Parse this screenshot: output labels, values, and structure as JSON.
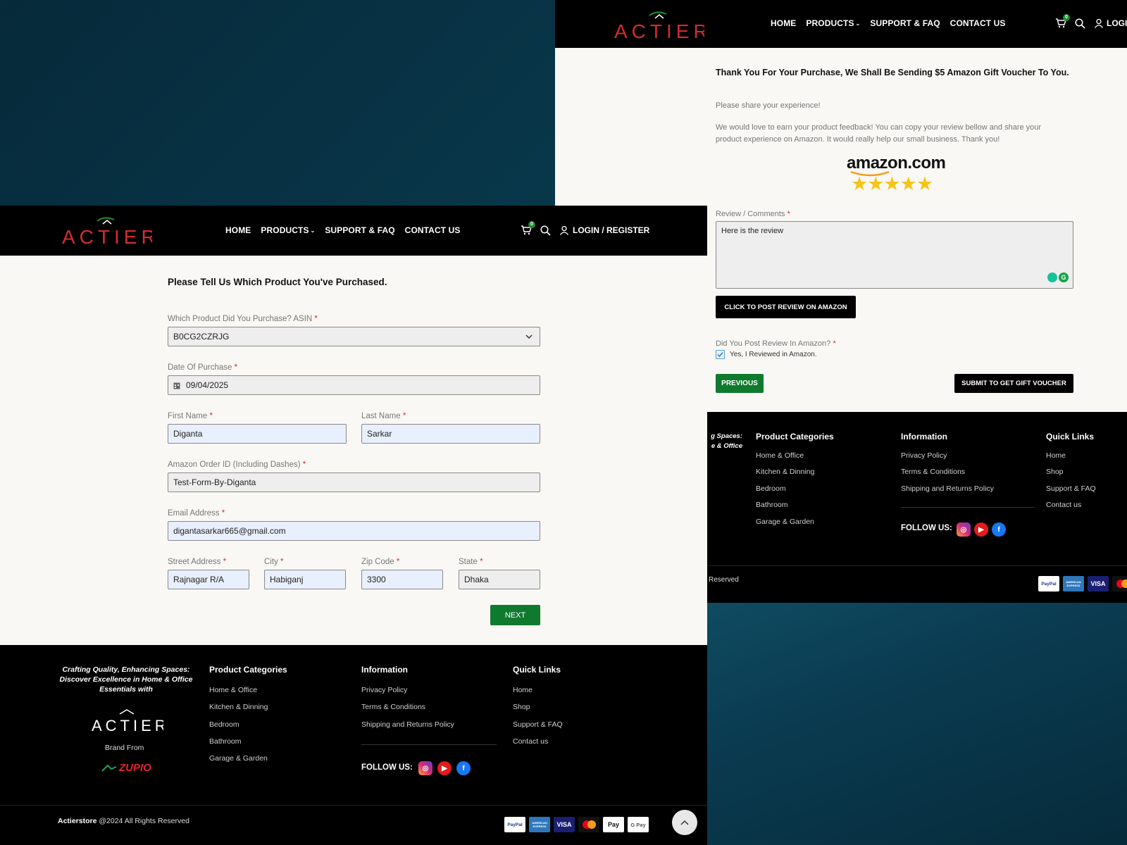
{
  "logo_text": "ACTIER",
  "nav": {
    "home": "HOME",
    "products": "PRODUCTS",
    "support": "SUPPORT & FAQ",
    "contact": "CONTACT US",
    "login_full": "LOGIN / REGISTER",
    "login_cut": "LOGI",
    "cart_count": "0"
  },
  "form1": {
    "title": "Please Tell Us Which Product You've Purchased.",
    "asin_label": "Which Product Did You Purchase? ASIN",
    "asin_value": "B0CG2CZRJG",
    "date_label": "Date Of Purchase",
    "date_value": "09/04/2025",
    "first_label": "First Name",
    "first_value": "Diganta",
    "last_label": "Last Name",
    "last_value": "Sarkar",
    "order_label": "Amazon Order ID (Including Dashes)",
    "order_value": "Test-Form-By-Diganta",
    "email_label": "Email Address",
    "email_value": "digantasarkar665@gmail.com",
    "street_label": "Street Address",
    "street_value": "Rajnagar R/A",
    "city_label": "City",
    "city_value": "Habiganj",
    "zip_label": "Zip Code",
    "zip_value": "3300",
    "state_label": "State",
    "state_value": "Dhaka",
    "next": "NEXT",
    "required_mark": "*"
  },
  "form2": {
    "title": "Thank You For Your Purchase, We Shall Be Sending $5 Amazon Gift Voucher To You.",
    "share": "Please share your experience!",
    "para": "We would love to earn your product feedback! You can copy your review bellow and share your product experience on Amazon. It would really help our small business. Thank you!",
    "amazon_logo": "amazon.com",
    "stars": "★★★★★",
    "review_label": "Review / Comments",
    "review_value": "Here is the review",
    "post_btn": "CLICK TO POST REVIEW ON AMAZON",
    "posted_label": "Did You Post Review In Amazon?",
    "checkbox_label": "Yes, I Reviewed in Amazon.",
    "prev": "PREVIOUS",
    "submit": "SUBMIT TO GET GIFT VOUCHER"
  },
  "footer": {
    "tagline": "Crafting Quality, Enhancing Spaces: Discover Excellence in Home & Office Essentials with",
    "tagline_cut1": "g Spaces:",
    "tagline_cut2": "e & Office",
    "brand_from": "Brand From",
    "zupio": "ZUPIO",
    "cat_title": "Product Categories",
    "cats": [
      "Home & Office",
      "Kitchen & Dinning",
      "Bedroom",
      "Bathroom",
      "Garage & Garden"
    ],
    "info_title": "Information",
    "info": [
      "Privacy Policy",
      "Terms & Conditions",
      "Shipping and Returns Policy"
    ],
    "follow": "FOLLOW US:",
    "quick_title": "Quick Links",
    "quick": [
      "Home",
      "Shop",
      "Support & FAQ",
      "Contact us"
    ],
    "copy_brand": "Actierstore",
    "copy_rest": "@2024 All Rights Reserved",
    "copy_cut": "Reserved",
    "payments": [
      "PayPal",
      "AMERICAN EXPRESS",
      "VISA",
      "MC",
      "Pay",
      "G Pay"
    ]
  },
  "colors": {
    "green": "#0f7a2e",
    "red_logo": "#d42c2c",
    "star": "#f5c518"
  }
}
